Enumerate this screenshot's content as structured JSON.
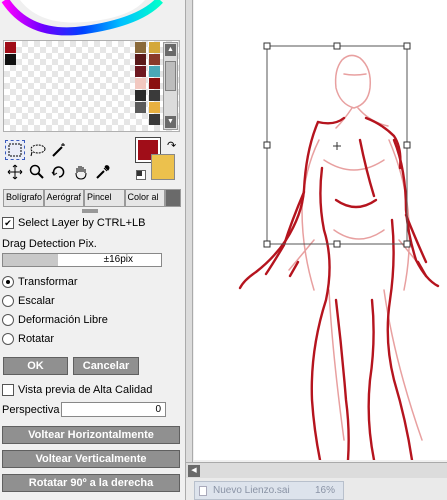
{
  "tool_panel": {
    "brush_tabs": [
      "Bolígrafo",
      "Aerógraf",
      "Pincel",
      "Color al"
    ],
    "select_layer_label": "Select Layer by CTRL+LB",
    "drag_detection_label": "Drag Detection Pix.",
    "drag_detection_value": "±16pix",
    "drag_detection_fraction": 0.35,
    "mode_options": [
      "Transformar",
      "Escalar",
      "Deformación Libre",
      "Rotatar"
    ],
    "mode_selected": "Transformar",
    "ok_label": "OK",
    "cancel_label": "Cancelar",
    "hq_preview_label": "Vista previa de Alta Calidad",
    "perspective_label": "Perspectiva",
    "perspective_value": "0",
    "flip_h_label": "Voltear Horizontalmente",
    "flip_v_label": "Voltear Verticalmente",
    "rotate_label": "Rotatar 90º a la derecha",
    "foreground_color": "#a00d18",
    "background_color": "#ecc14d"
  },
  "status": {
    "document_name": "Nuevo Lienzo.sai",
    "zoom": "16%"
  },
  "icons": [
    "selection-rect-icon",
    "lasso-icon",
    "magic-wand-icon",
    "move-icon",
    "zoom-icon",
    "rotate-icon",
    "hand-icon",
    "eyedropper-icon",
    "swap-colors-icon",
    "reset-colors-icon"
  ]
}
